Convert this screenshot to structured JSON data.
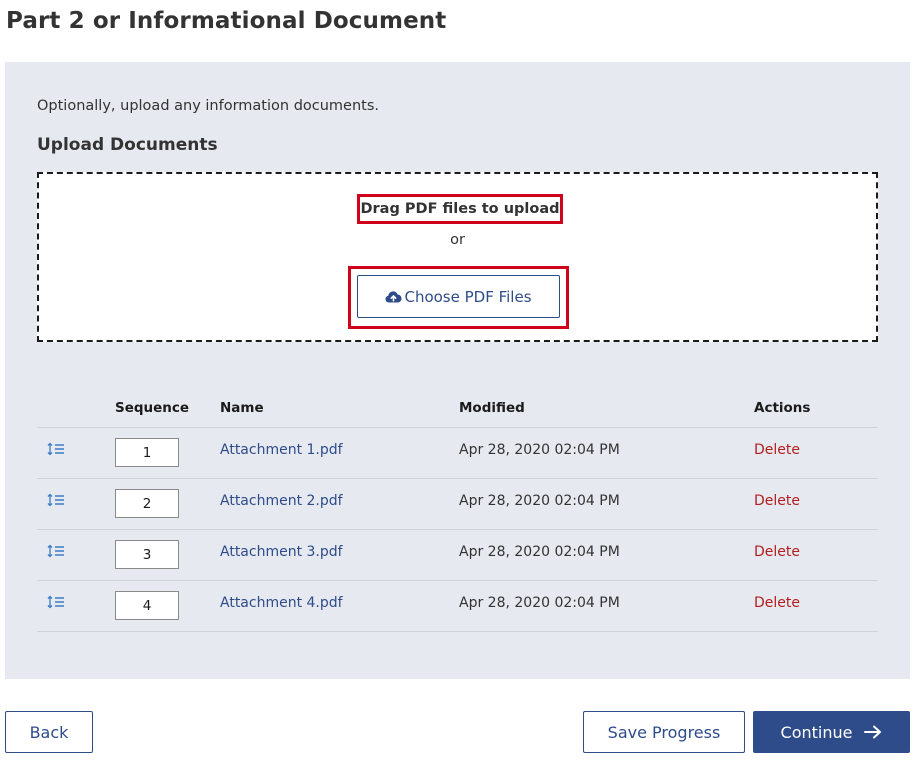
{
  "page": {
    "title": "Part 2 or Informational Document"
  },
  "upload": {
    "intro": "Optionally, upload any information documents.",
    "heading": "Upload Documents",
    "drag_text": "Drag PDF files to upload",
    "or_text": "or",
    "choose_label": "Choose PDF Files",
    "choose_icon": "cloud-upload-icon"
  },
  "table": {
    "headers": {
      "sequence": "Sequence",
      "name": "Name",
      "modified": "Modified",
      "actions": "Actions"
    },
    "rows": [
      {
        "sequence": "1",
        "name": "Attachment 1.pdf",
        "modified": "Apr 28, 2020 02:04 PM",
        "action": "Delete"
      },
      {
        "sequence": "2",
        "name": "Attachment 2.pdf",
        "modified": "Apr 28, 2020 02:04 PM",
        "action": "Delete"
      },
      {
        "sequence": "3",
        "name": "Attachment 3.pdf",
        "modified": "Apr 28, 2020 02:04 PM",
        "action": "Delete"
      },
      {
        "sequence": "4",
        "name": "Attachment 4.pdf",
        "modified": "Apr 28, 2020 02:04 PM",
        "action": "Delete"
      }
    ],
    "handle_icon": "reorder-list-icon"
  },
  "footer": {
    "back_label": "Back",
    "save_label": "Save Progress",
    "continue_label": "Continue",
    "continue_icon": "arrow-right-icon"
  },
  "colors": {
    "primary": "#2e4c8a",
    "danger": "#b31e1e",
    "panel_bg": "#e6e9ef",
    "highlight": "#d0021b"
  }
}
